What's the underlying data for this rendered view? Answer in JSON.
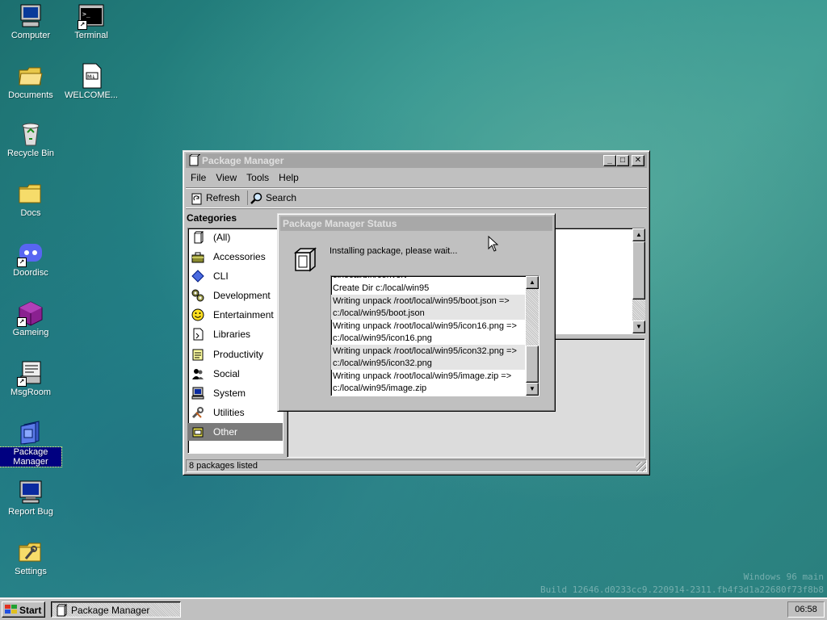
{
  "desktop": {
    "icons": [
      {
        "label": "Computer",
        "icon": "computer-icon"
      },
      {
        "label": "Terminal",
        "icon": "terminal-icon"
      },
      {
        "label": "Documents",
        "icon": "folder-open-icon"
      },
      {
        "label": "WELCOME...",
        "icon": "markdown-file-icon"
      },
      {
        "label": "Recycle Bin",
        "icon": "recycle-bin-icon"
      },
      {
        "label": "Docs",
        "icon": "folder-icon"
      },
      {
        "label": "Doordisc",
        "icon": "discord-icon"
      },
      {
        "label": "Gameing",
        "icon": "cube-icon"
      },
      {
        "label": "MsgRoom",
        "icon": "chat-computer-icon"
      },
      {
        "label": "Package Manager",
        "icon": "package-icon"
      },
      {
        "label": "Report Bug",
        "icon": "monitor-icon"
      },
      {
        "label": "Settings",
        "icon": "settings-folder-icon"
      }
    ],
    "watermark_line1": "Windows 96 main",
    "watermark_line2": "Build 12646.d0233cc9.220914-2311.fb4f3d1a22680f73f8b8"
  },
  "package_manager": {
    "title": "Package Manager",
    "menu": [
      "File",
      "View",
      "Tools",
      "Help"
    ],
    "toolbar": {
      "refresh_label": "Refresh",
      "search_label": "Search"
    },
    "categories_header": "Categories",
    "categories": [
      {
        "label": "(All)",
        "icon": "file-icon"
      },
      {
        "label": "Accessories",
        "icon": "toolbox-icon"
      },
      {
        "label": "CLI",
        "icon": "diamond-icon"
      },
      {
        "label": "Development",
        "icon": "gears-icon"
      },
      {
        "label": "Entertainment",
        "icon": "smiley-icon"
      },
      {
        "label": "Libraries",
        "icon": "library-file-icon"
      },
      {
        "label": "Productivity",
        "icon": "notepad-icon"
      },
      {
        "label": "Social",
        "icon": "people-icon"
      },
      {
        "label": "System",
        "icon": "computer-icon"
      },
      {
        "label": "Utilities",
        "icon": "tools-icon"
      },
      {
        "label": "Other",
        "icon": "other-box-icon"
      }
    ],
    "selected_category": "Other",
    "status_text": "8 packages listed"
  },
  "status_dialog": {
    "title": "Package Manager Status",
    "message": "Installing package, please wait...",
    "log": [
      "c:/local/bin/convert",
      "Create Dir c:/local/win95",
      "Writing unpack /root/local/win95/boot.json =>",
      "c:/local/win95/boot.json",
      "Writing unpack /root/local/win95/icon16.png =>",
      "c:/local/win95/icon16.png",
      "Writing unpack /root/local/win95/icon32.png =>",
      "c:/local/win95/icon32.png",
      "Writing unpack /root/local/win95/image.zip =>",
      "c:/local/win95/image.zip"
    ]
  },
  "taskbar": {
    "start_label": "Start",
    "task_label": "Package Manager",
    "clock": "06:58"
  }
}
